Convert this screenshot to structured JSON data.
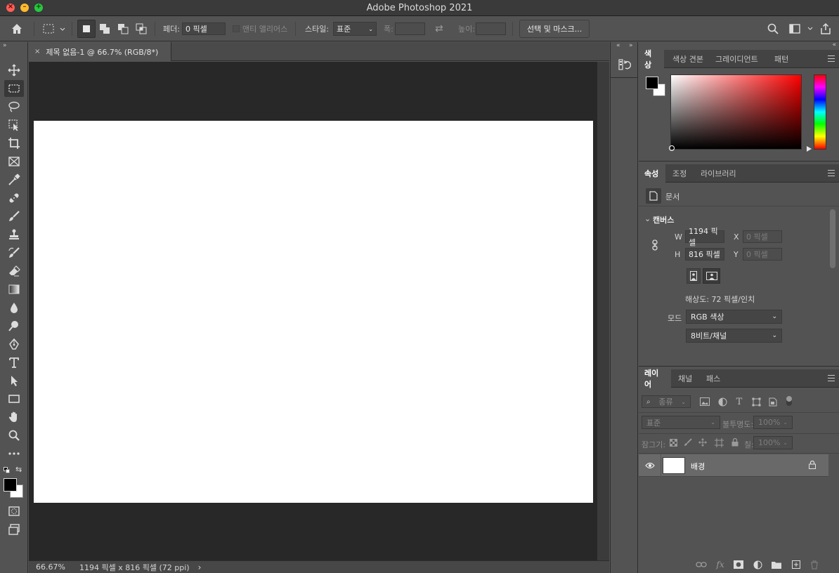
{
  "app": {
    "title": "Adobe Photoshop 2021"
  },
  "options_bar": {
    "feather_label": "페더:",
    "feather_value": "0 픽셀",
    "antialias_label": "앤티 앨리어스",
    "style_label": "스타일:",
    "style_value": "표준",
    "width_label": "폭:",
    "height_label": "높이:",
    "select_mask_button": "선택 및 마스크..."
  },
  "document": {
    "tab_title": "제목 없음-1 @ 66.7% (RGB/8*)",
    "close_glyph": "×",
    "zoom": "66.67%",
    "info": "1194 픽셀 x 816 픽셀 (72 ppi)"
  },
  "color_panel": {
    "tabs": [
      "색상",
      "색상 견본",
      "그레이디언트",
      "패턴"
    ],
    "active_tab": "색상",
    "foreground": "#000000",
    "background": "#ffffff"
  },
  "properties_panel": {
    "tabs": [
      "속성",
      "조정",
      "라이브러리"
    ],
    "active_tab": "속성",
    "doc_label": "문서",
    "section_canvas": "캔버스",
    "w_label": "W",
    "w_value": "1194 픽셀",
    "h_label": "H",
    "h_value": "816 픽셀",
    "x_label": "X",
    "x_placeholder": "0 픽셀",
    "y_label": "Y",
    "y_placeholder": "0 픽셀",
    "resolution": "해상도: 72 픽셀/인치",
    "mode_label": "모드",
    "mode_value": "RGB 색상",
    "bitdepth_value": "8비트/채널"
  },
  "layers_panel": {
    "tabs": [
      "레이어",
      "채널",
      "패스"
    ],
    "active_tab": "레이어",
    "filter_label": "종류",
    "blend_mode": "표준",
    "opacity_label": "불투명도:",
    "opacity_value": "100%",
    "lock_label": "잠그기:",
    "fill_label": "칠:",
    "fill_value": "100%",
    "layers": [
      {
        "name": "배경",
        "visible": true,
        "locked": true
      }
    ]
  },
  "tools": [
    "move-tool",
    "marquee-tool",
    "lasso-tool",
    "object-select-tool",
    "crop-tool",
    "frame-tool",
    "eyedropper-tool",
    "healing-brush-tool",
    "brush-tool",
    "clone-stamp-tool",
    "history-brush-tool",
    "eraser-tool",
    "gradient-tool",
    "blur-tool",
    "dodge-tool",
    "pen-tool",
    "type-tool",
    "path-select-tool",
    "rectangle-tool",
    "hand-tool",
    "zoom-tool",
    "more-tools"
  ]
}
